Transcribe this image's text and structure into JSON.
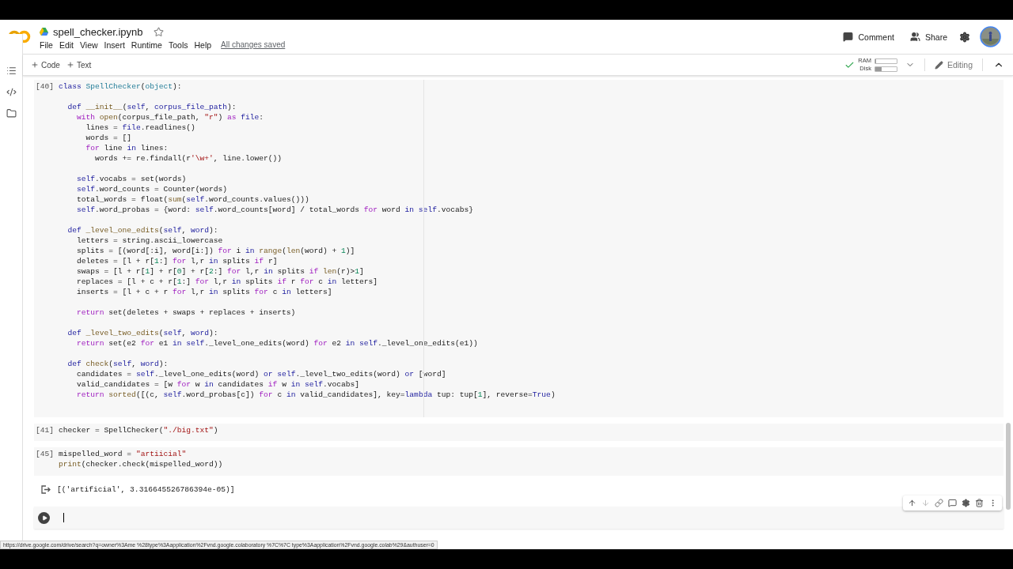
{
  "header": {
    "title": "spell_checker.ipynb",
    "starred": false,
    "menu": [
      "File",
      "Edit",
      "View",
      "Insert",
      "Runtime",
      "Tools",
      "Help"
    ],
    "save_status": "All changes saved",
    "actions": [
      {
        "kind": "comment",
        "label": "Comment"
      },
      {
        "kind": "share",
        "label": "Share"
      }
    ]
  },
  "toolbar": {
    "add_buttons": [
      "Code",
      "Text"
    ],
    "resources": {
      "connected": true,
      "meters": [
        {
          "label": "RAM",
          "level": 0.05
        },
        {
          "label": "Disk",
          "level": 0.3
        }
      ]
    },
    "mode": "Editing"
  },
  "cells": [
    {
      "kind": "code",
      "count": "[40]",
      "lines": [
        {
          "segs": [
            {
              "kind": "keyword",
              "text": "class"
            },
            {
              "kind": "type",
              "text": " SpellChecker"
            },
            {
              "kind": "plain",
              "text": "("
            },
            {
              "kind": "type",
              "text": "object"
            },
            {
              "kind": "plain",
              "text": "):"
            }
          ]
        },
        {
          "gap": true,
          "segs": [
            {
              "kind": "keyword",
              "text": "  def"
            },
            {
              "kind": "builtin",
              "text": " __init__"
            },
            {
              "kind": "plain",
              "text": "("
            },
            {
              "kind": "keyword",
              "text": "self"
            },
            {
              "kind": "plain",
              "text": ", "
            },
            {
              "kind": "keyword",
              "text": "corpus_file_path"
            },
            {
              "kind": "plain",
              "text": "):"
            }
          ]
        },
        {
          "segs": [
            {
              "kind": "control",
              "text": "    with"
            },
            {
              "kind": "builtin",
              "text": " open"
            },
            {
              "kind": "plain",
              "text": "(corpus_file_path, "
            },
            {
              "kind": "string",
              "text": "\"r\""
            },
            {
              "kind": "plain",
              "text": ") "
            },
            {
              "kind": "control",
              "text": "as"
            },
            {
              "kind": "keyword",
              "text": " file"
            },
            {
              "kind": "plain",
              "text": ":"
            }
          ]
        },
        {
          "segs": [
            {
              "kind": "plain",
              "text": "      lines = "
            },
            {
              "kind": "keyword",
              "text": "file"
            },
            {
              "kind": "plain",
              "text": ".readlines()"
            }
          ]
        },
        {
          "segs": [
            {
              "kind": "plain",
              "text": "      words = []"
            }
          ]
        },
        {
          "segs": [
            {
              "kind": "control",
              "text": "      for"
            },
            {
              "kind": "plain",
              "text": " line "
            },
            {
              "kind": "keyword",
              "text": "in"
            },
            {
              "kind": "plain",
              "text": " lines:"
            }
          ]
        },
        {
          "segs": [
            {
              "kind": "plain",
              "text": "        words += re.findall(r"
            },
            {
              "kind": "string",
              "text": "'\\w+'"
            },
            {
              "kind": "plain",
              "text": ", line.lower())"
            }
          ]
        },
        {
          "gap": true,
          "segs": [
            {
              "kind": "keyword",
              "text": "    self"
            },
            {
              "kind": "plain",
              "text": ".vocabs = set(words)"
            }
          ]
        },
        {
          "segs": [
            {
              "kind": "keyword",
              "text": "    self"
            },
            {
              "kind": "plain",
              "text": ".word_counts = Counter(words)"
            }
          ]
        },
        {
          "segs": [
            {
              "kind": "plain",
              "text": "    total_words = float("
            },
            {
              "kind": "builtin",
              "text": "sum"
            },
            {
              "kind": "plain",
              "text": "("
            },
            {
              "kind": "keyword",
              "text": "self"
            },
            {
              "kind": "plain",
              "text": ".word_counts.values()))"
            }
          ]
        },
        {
          "segs": [
            {
              "kind": "keyword",
              "text": "    self"
            },
            {
              "kind": "plain",
              "text": ".word_probas = {word: "
            },
            {
              "kind": "keyword",
              "text": "self"
            },
            {
              "kind": "plain",
              "text": ".word_counts[word] / total_words "
            },
            {
              "kind": "control",
              "text": "for"
            },
            {
              "kind": "plain",
              "text": " word "
            },
            {
              "kind": "keyword",
              "text": "in self"
            },
            {
              "kind": "plain",
              "text": ".vocabs}"
            }
          ]
        },
        {
          "gap": true,
          "segs": [
            {
              "kind": "keyword",
              "text": "  def"
            },
            {
              "kind": "builtin",
              "text": " _level_one_edits"
            },
            {
              "kind": "plain",
              "text": "("
            },
            {
              "kind": "keyword",
              "text": "self"
            },
            {
              "kind": "plain",
              "text": ", "
            },
            {
              "kind": "keyword",
              "text": "word"
            },
            {
              "kind": "plain",
              "text": "):"
            }
          ]
        },
        {
          "segs": [
            {
              "kind": "plain",
              "text": "    letters = string.ascii_lowercase"
            }
          ]
        },
        {
          "segs": [
            {
              "kind": "plain",
              "text": "    splits = [(word[:i], word[i:]) "
            },
            {
              "kind": "control",
              "text": "for"
            },
            {
              "kind": "plain",
              "text": " i "
            },
            {
              "kind": "keyword",
              "text": "in"
            },
            {
              "kind": "builtin",
              "text": " range"
            },
            {
              "kind": "plain",
              "text": "("
            },
            {
              "kind": "builtin",
              "text": "len"
            },
            {
              "kind": "plain",
              "text": "(word) + "
            },
            {
              "kind": "number",
              "text": "1"
            },
            {
              "kind": "plain",
              "text": ")]"
            }
          ]
        },
        {
          "segs": [
            {
              "kind": "plain",
              "text": "    deletes = [l + r["
            },
            {
              "kind": "number",
              "text": "1"
            },
            {
              "kind": "plain",
              "text": ":] "
            },
            {
              "kind": "control",
              "text": "for"
            },
            {
              "kind": "plain",
              "text": " l,r "
            },
            {
              "kind": "keyword",
              "text": "in"
            },
            {
              "kind": "plain",
              "text": " splits "
            },
            {
              "kind": "control",
              "text": "if"
            },
            {
              "kind": "plain",
              "text": " r]"
            }
          ]
        },
        {
          "segs": [
            {
              "kind": "plain",
              "text": "    swaps = [l + r["
            },
            {
              "kind": "number",
              "text": "1"
            },
            {
              "kind": "plain",
              "text": "] + r["
            },
            {
              "kind": "number",
              "text": "0"
            },
            {
              "kind": "plain",
              "text": "] + r["
            },
            {
              "kind": "number",
              "text": "2"
            },
            {
              "kind": "plain",
              "text": ":] "
            },
            {
              "kind": "control",
              "text": "for"
            },
            {
              "kind": "plain",
              "text": " l,r "
            },
            {
              "kind": "keyword",
              "text": "in"
            },
            {
              "kind": "plain",
              "text": " splits "
            },
            {
              "kind": "control",
              "text": "if"
            },
            {
              "kind": "builtin",
              "text": " len"
            },
            {
              "kind": "plain",
              "text": "(r)>"
            },
            {
              "kind": "number",
              "text": "1"
            },
            {
              "kind": "plain",
              "text": "]"
            }
          ]
        },
        {
          "segs": [
            {
              "kind": "plain",
              "text": "    replaces = [l + c + r["
            },
            {
              "kind": "number",
              "text": "1"
            },
            {
              "kind": "plain",
              "text": ":] "
            },
            {
              "kind": "control",
              "text": "for"
            },
            {
              "kind": "plain",
              "text": " l,r "
            },
            {
              "kind": "keyword",
              "text": "in"
            },
            {
              "kind": "plain",
              "text": " splits "
            },
            {
              "kind": "control",
              "text": "if"
            },
            {
              "kind": "plain",
              "text": " r "
            },
            {
              "kind": "control",
              "text": "for"
            },
            {
              "kind": "plain",
              "text": " c "
            },
            {
              "kind": "keyword",
              "text": "in"
            },
            {
              "kind": "plain",
              "text": " letters]"
            }
          ]
        },
        {
          "segs": [
            {
              "kind": "plain",
              "text": "    inserts = [l + c + r "
            },
            {
              "kind": "control",
              "text": "for"
            },
            {
              "kind": "plain",
              "text": " l,r "
            },
            {
              "kind": "keyword",
              "text": "in"
            },
            {
              "kind": "plain",
              "text": " splits "
            },
            {
              "kind": "control",
              "text": "for"
            },
            {
              "kind": "plain",
              "text": " c "
            },
            {
              "kind": "keyword",
              "text": "in"
            },
            {
              "kind": "plain",
              "text": " letters]"
            }
          ]
        },
        {
          "gap": true,
          "segs": [
            {
              "kind": "control",
              "text": "    return"
            },
            {
              "kind": "plain",
              "text": " set(deletes + swaps + replaces + inserts)"
            }
          ]
        },
        {
          "gap": true,
          "segs": [
            {
              "kind": "keyword",
              "text": "  def"
            },
            {
              "kind": "builtin",
              "text": " _level_two_edits"
            },
            {
              "kind": "plain",
              "text": "("
            },
            {
              "kind": "keyword",
              "text": "self"
            },
            {
              "kind": "plain",
              "text": ", "
            },
            {
              "kind": "keyword",
              "text": "word"
            },
            {
              "kind": "plain",
              "text": "):"
            }
          ]
        },
        {
          "segs": [
            {
              "kind": "control",
              "text": "    return"
            },
            {
              "kind": "plain",
              "text": " set(e2 "
            },
            {
              "kind": "control",
              "text": "for"
            },
            {
              "kind": "plain",
              "text": " e1 "
            },
            {
              "kind": "keyword",
              "text": "in self"
            },
            {
              "kind": "plain",
              "text": "._level_one_edits(word) "
            },
            {
              "kind": "control",
              "text": "for"
            },
            {
              "kind": "plain",
              "text": " e2 "
            },
            {
              "kind": "keyword",
              "text": "in self"
            },
            {
              "kind": "plain",
              "text": "._level_one_edits(e1))"
            }
          ]
        },
        {
          "gap": true,
          "segs": [
            {
              "kind": "keyword",
              "text": "  def"
            },
            {
              "kind": "builtin",
              "text": " check"
            },
            {
              "kind": "plain",
              "text": "("
            },
            {
              "kind": "keyword",
              "text": "self"
            },
            {
              "kind": "plain",
              "text": ", "
            },
            {
              "kind": "keyword",
              "text": "word"
            },
            {
              "kind": "plain",
              "text": "):"
            }
          ]
        },
        {
          "segs": [
            {
              "kind": "plain",
              "text": "    candidates = "
            },
            {
              "kind": "keyword",
              "text": "self"
            },
            {
              "kind": "plain",
              "text": "._level_one_edits(word) "
            },
            {
              "kind": "keyword",
              "text": "or self"
            },
            {
              "kind": "plain",
              "text": "._level_two_edits(word) "
            },
            {
              "kind": "keyword",
              "text": "or"
            },
            {
              "kind": "plain",
              "text": " [word]"
            }
          ]
        },
        {
          "segs": [
            {
              "kind": "plain",
              "text": "    valid_candidates = [w "
            },
            {
              "kind": "control",
              "text": "for"
            },
            {
              "kind": "plain",
              "text": " w "
            },
            {
              "kind": "keyword",
              "text": "in"
            },
            {
              "kind": "plain",
              "text": " candidates "
            },
            {
              "kind": "control",
              "text": "if"
            },
            {
              "kind": "plain",
              "text": " w "
            },
            {
              "kind": "keyword",
              "text": "in self"
            },
            {
              "kind": "plain",
              "text": ".vocabs]"
            }
          ]
        },
        {
          "segs": [
            {
              "kind": "control",
              "text": "    return"
            },
            {
              "kind": "builtin",
              "text": " sorted"
            },
            {
              "kind": "plain",
              "text": "([(c, "
            },
            {
              "kind": "keyword",
              "text": "self"
            },
            {
              "kind": "plain",
              "text": ".word_probas[c]) "
            },
            {
              "kind": "control",
              "text": "for"
            },
            {
              "kind": "plain",
              "text": " c "
            },
            {
              "kind": "keyword",
              "text": "in"
            },
            {
              "kind": "plain",
              "text": " valid_candidates], key="
            },
            {
              "kind": "keyword",
              "text": "lambda"
            },
            {
              "kind": "plain",
              "text": " tup: tup["
            },
            {
              "kind": "number",
              "text": "1"
            },
            {
              "kind": "plain",
              "text": "], reverse="
            },
            {
              "kind": "keyword",
              "text": "True"
            },
            {
              "kind": "plain",
              "text": ")"
            }
          ]
        }
      ]
    },
    {
      "kind": "code",
      "count": "[41]",
      "lines": [
        {
          "segs": [
            {
              "kind": "plain",
              "text": "checker = SpellChecker("
            },
            {
              "kind": "string",
              "text": "\"./big.txt\""
            },
            {
              "kind": "plain",
              "text": ")"
            }
          ]
        }
      ]
    },
    {
      "kind": "code",
      "count": "[45]",
      "lines": [
        {
          "segs": [
            {
              "kind": "plain",
              "text": "mispelled_word = "
            },
            {
              "kind": "string",
              "text": "\"artiicial\""
            }
          ]
        },
        {
          "segs": [
            {
              "kind": "builtin",
              "text": "print"
            },
            {
              "kind": "plain",
              "text": "(checker.check(mispelled_word))"
            }
          ]
        }
      ],
      "output": "[('artificial', 3.316645526786394e-05)]"
    },
    {
      "kind": "active"
    }
  ],
  "status_url": "https://drive.google.com/drive/search?q=owner%3Ame %28type%3Aapplication%2Fvnd.google.colaboratory %7C%7C type%3Aapplication%2Fvnd.google.colab%29&authuser=0"
}
